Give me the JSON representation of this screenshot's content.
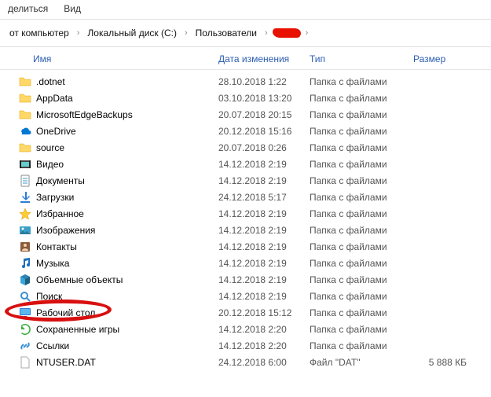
{
  "menu": {
    "share": "делиться",
    "view": "Вид"
  },
  "breadcrumb": [
    "от компьютер",
    "Локальный диск (C:)",
    "Пользователи"
  ],
  "columns": {
    "name": "Имя",
    "date": "Дата изменения",
    "type": "Тип",
    "size": "Размер"
  },
  "type_folder": "Папка с файлами",
  "items": [
    {
      "icon": "folder",
      "name": ".dotnet",
      "date": "28.10.2018 1:22",
      "type": "Папка с файлами",
      "size": ""
    },
    {
      "icon": "folder",
      "name": "AppData",
      "date": "03.10.2018 13:20",
      "type": "Папка с файлами",
      "size": ""
    },
    {
      "icon": "folder",
      "name": "MicrosoftEdgeBackups",
      "date": "20.07.2018 20:15",
      "type": "Папка с файлами",
      "size": ""
    },
    {
      "icon": "onedrive",
      "name": "OneDrive",
      "date": "20.12.2018 15:16",
      "type": "Папка с файлами",
      "size": ""
    },
    {
      "icon": "folder",
      "name": "source",
      "date": "20.07.2018 0:26",
      "type": "Папка с файлами",
      "size": ""
    },
    {
      "icon": "video",
      "name": "Видео",
      "date": "14.12.2018 2:19",
      "type": "Папка с файлами",
      "size": ""
    },
    {
      "icon": "docs",
      "name": "Документы",
      "date": "14.12.2018 2:19",
      "type": "Папка с файлами",
      "size": ""
    },
    {
      "icon": "download",
      "name": "Загрузки",
      "date": "24.12.2018 5:17",
      "type": "Папка с файлами",
      "size": ""
    },
    {
      "icon": "star",
      "name": "Избранное",
      "date": "14.12.2018 2:19",
      "type": "Папка с файлами",
      "size": ""
    },
    {
      "icon": "pictures",
      "name": "Изображения",
      "date": "14.12.2018 2:19",
      "type": "Папка с файлами",
      "size": ""
    },
    {
      "icon": "contacts",
      "name": "Контакты",
      "date": "14.12.2018 2:19",
      "type": "Папка с файлами",
      "size": ""
    },
    {
      "icon": "music",
      "name": "Музыка",
      "date": "14.12.2018 2:19",
      "type": "Папка с файлами",
      "size": ""
    },
    {
      "icon": "objects",
      "name": "Объемные объекты",
      "date": "14.12.2018 2:19",
      "type": "Папка с файлами",
      "size": ""
    },
    {
      "icon": "search",
      "name": "Поиск",
      "date": "14.12.2018 2:19",
      "type": "Папка с файлами",
      "size": ""
    },
    {
      "icon": "desktop",
      "name": "Рабочий стол",
      "date": "20.12.2018 15:12",
      "type": "Папка с файлами",
      "size": "",
      "circled": true
    },
    {
      "icon": "saved",
      "name": "Сохраненные игры",
      "date": "14.12.2018 2:20",
      "type": "Папка с файлами",
      "size": ""
    },
    {
      "icon": "links",
      "name": "Ссылки",
      "date": "14.12.2018 2:20",
      "type": "Папка с файлами",
      "size": ""
    },
    {
      "icon": "file",
      "name": "NTUSER.DAT",
      "date": "24.12.2018 6:00",
      "type": "Файл \"DAT\"",
      "size": "5 888 КБ"
    }
  ]
}
